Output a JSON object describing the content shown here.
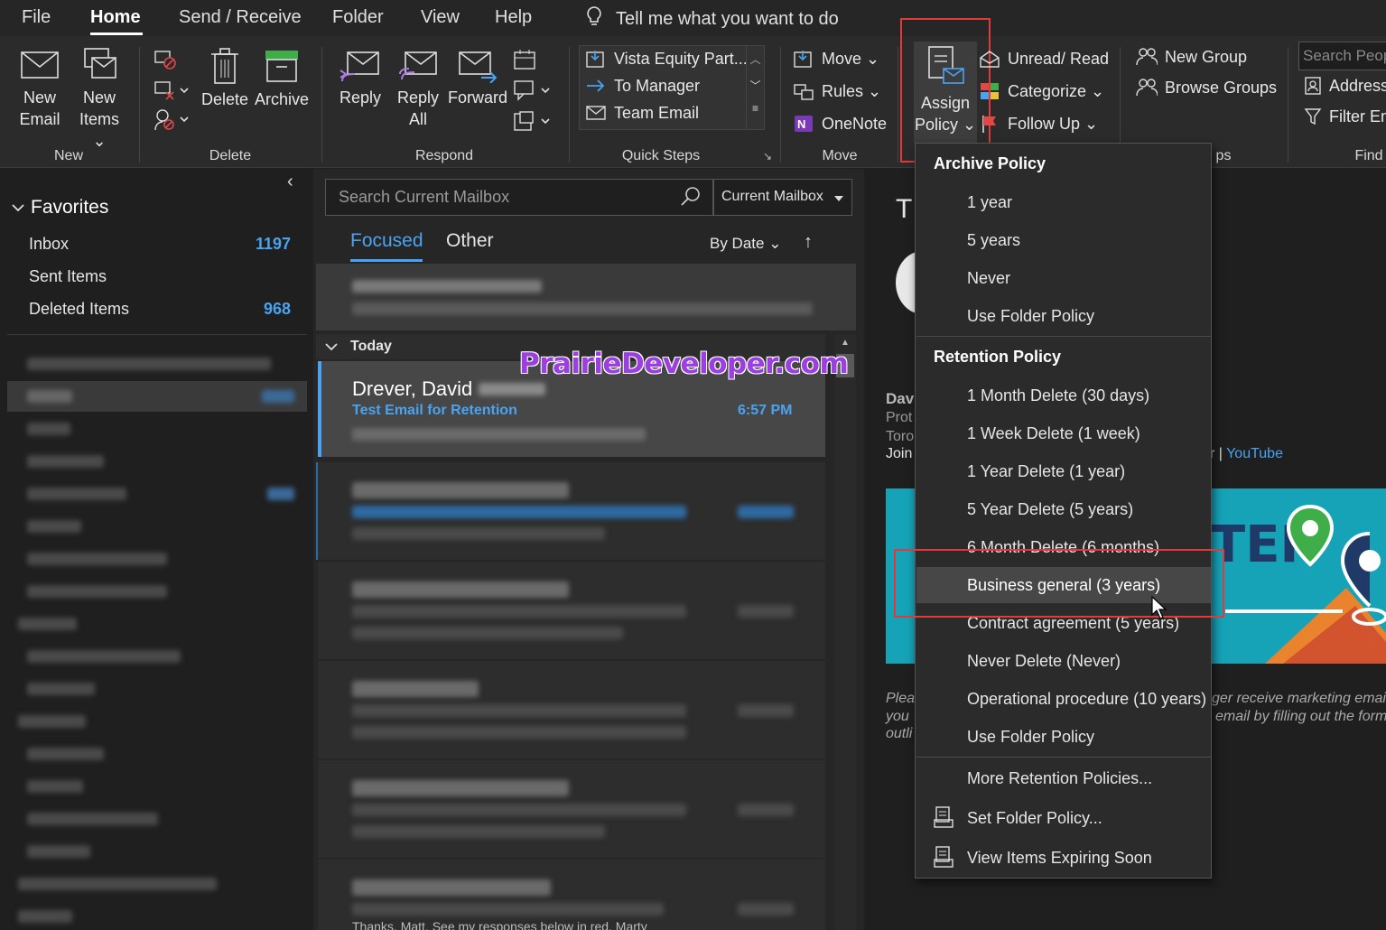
{
  "menu": {
    "tabs": [
      "File",
      "Home",
      "Send / Receive",
      "Folder",
      "View",
      "Help"
    ],
    "tellme": "Tell me what you want to do"
  },
  "ribbon": {
    "new": {
      "label": "New",
      "new_email": "New Email",
      "new_email_1": "New",
      "new_email_2": "Email",
      "new_items_1": "New",
      "new_items_2": "Items ⌄"
    },
    "delete": {
      "label": "Delete",
      "delete_btn": "Delete",
      "archive_btn": "Archive"
    },
    "respond": {
      "label": "Respond",
      "reply": "Reply",
      "reply_all_1": "Reply",
      "reply_all_2": "All",
      "forward": "Forward"
    },
    "quick_steps": {
      "label": "Quick Steps",
      "items": [
        "Vista Equity Part...",
        "To Manager",
        "Team Email"
      ]
    },
    "move": {
      "label": "Move",
      "move_btn": "Move ⌄",
      "rules_btn": "Rules ⌄",
      "onenote_btn": "OneNote"
    },
    "tags": {
      "assign_1": "Assign",
      "assign_2": "Policy ⌄",
      "unread_read": "Unread/ Read",
      "categorize": "Categorize ⌄",
      "follow_up": "Follow Up ⌄"
    },
    "groups": {
      "label": "ps",
      "new_group": "New Group",
      "browse_groups": "Browse Groups"
    },
    "find": {
      "label": "Find",
      "search_people": "Search Peop",
      "address": "Address",
      "filter": "Filter Em"
    }
  },
  "folders": {
    "favorites_label": "Favorites",
    "favorites": [
      {
        "name": "Inbox",
        "count": "1197"
      },
      {
        "name": "Sent Items",
        "count": ""
      },
      {
        "name": "Deleted Items",
        "count": "968"
      }
    ]
  },
  "messages": {
    "search_placeholder": "Search Current Mailbox",
    "scope": "Current Mailbox",
    "focused": "Focused",
    "other": "Other",
    "sort": "By Date ⌄",
    "group_today": "Today",
    "selected": {
      "sender": "Drever, David",
      "subject": "Test Email for Retention",
      "time": "6:57 PM"
    },
    "bottom_preview": "Thanks, Matt.  See my responses below in red.  Marty"
  },
  "watermark": "PrairieDeveloper.com",
  "reading": {
    "title_fragment": "T",
    "sender_fragment": "Dav",
    "line1": "Prot",
    "line2": "Toro",
    "line3": "Join",
    "links_fragment": "r | ",
    "youtube": "YouTube",
    "banner_text": "TEP",
    "footer1": "Plea",
    "footer2": "you",
    "footer3": "outli",
    "footer_right1": "ger receive marketing emai",
    "footer_right2": "email by filling out the form"
  },
  "dropdown": {
    "archive_header": "Archive Policy",
    "archive_items": [
      "1 year",
      "5 years",
      "Never",
      "Use Folder Policy"
    ],
    "retention_header": "Retention Policy",
    "retention_items": [
      "1 Month Delete (30 days)",
      "1 Week Delete (1 week)",
      "1 Year Delete (1 year)",
      "5 Year Delete (5 years)",
      "6 Month Delete (6 months)",
      "Business general (3 years)",
      "Contract agreement (5 years)",
      "Never Delete (Never)",
      "Operational procedure (10 years)",
      "Use Folder Policy"
    ],
    "more": "More Retention Policies...",
    "set_folder": "Set Folder Policy...",
    "view_expiring": "View Items Expiring Soon",
    "selected_index": 5
  },
  "colors": {
    "accent": "#4aa3f0",
    "highlight": "#e03a3a",
    "watermark": "#9b3fe0"
  }
}
